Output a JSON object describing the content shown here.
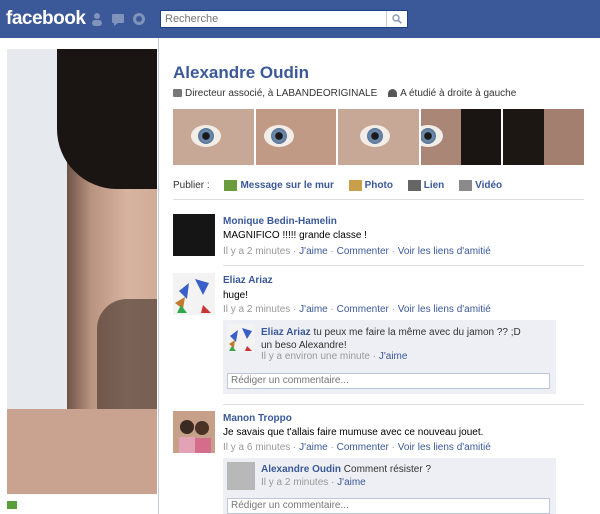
{
  "app": {
    "logo": "facebook"
  },
  "search": {
    "placeholder": "Recherche"
  },
  "profile": {
    "name": "Alexandre Oudin",
    "work": "Directeur associé, à LABANDEORIGINALE",
    "education": "A étudié à droite à gauche"
  },
  "publish": {
    "label": "Publier :",
    "options": [
      "Message sur le mur",
      "Photo",
      "Lien",
      "Vidéo"
    ]
  },
  "stories": [
    {
      "author": "Monique Bedin-Hamelin",
      "text": "MAGNIFICO !!!!! grande classe !",
      "time": "Il y a 2 minutes",
      "like": "J'aime",
      "comment": "Commenter",
      "friendship": "Voir les liens d'amitié"
    },
    {
      "author": "Eliaz Ariaz",
      "text": "huge!",
      "time": "Il y a 2 minutes",
      "like": "J'aime",
      "comment": "Commenter",
      "friendship": "Voir les liens d'amitié",
      "comments": [
        {
          "author": "Eliaz Ariaz",
          "text": "tu peux me faire la même avec du jamon ?? ;D",
          "text2": "un beso Alexandre!",
          "time": "Il y a environ une minute",
          "like": "J'aime"
        }
      ],
      "comment_placeholder": "Rédiger un commentaire..."
    },
    {
      "author": "Manon Troppo",
      "text": "Je savais que t'allais faire mumuse avec ce nouveau jouet.",
      "time": "Il y a 6 minutes",
      "like": "J'aime",
      "comment": "Commenter",
      "friendship": "Voir les liens d'amitié",
      "comments": [
        {
          "author": "Alexandre Oudin",
          "text": "Comment résister ?",
          "time": "Il y a 2 minutes",
          "like": "J'aime"
        }
      ],
      "comment_placeholder": "Rédiger un commentaire..."
    }
  ],
  "colors": {
    "brand": "#3b5998",
    "comment_bg": "#edeff4"
  },
  "icons": [
    "friends-icon",
    "messages-icon",
    "notifications-icon",
    "search-icon"
  ]
}
